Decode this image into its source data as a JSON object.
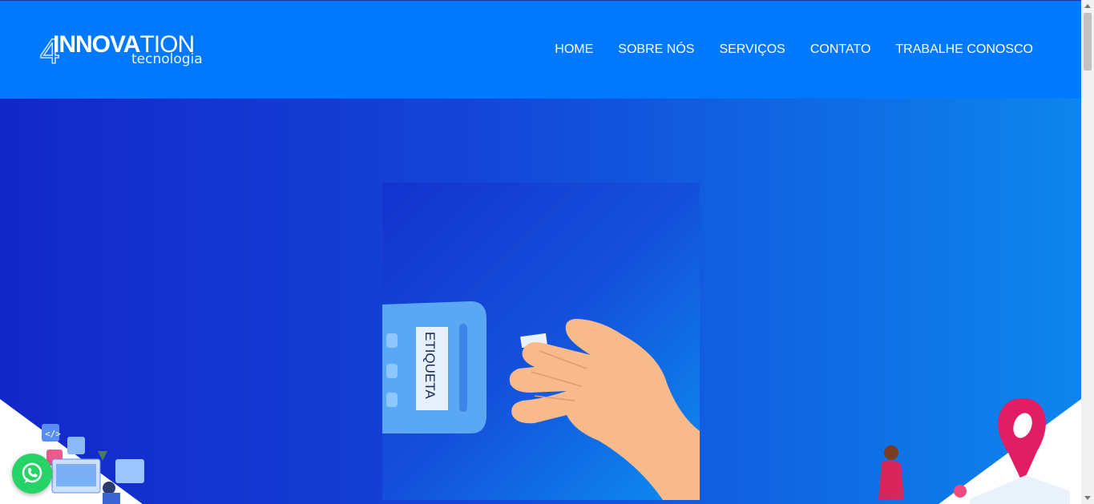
{
  "brand": {
    "logo_main_bold": "INNOVA",
    "logo_main_thin": "TION",
    "logo_digit": "4",
    "logo_sub": "tecnologia"
  },
  "nav": {
    "items": [
      "HOME",
      "SOBRE NÓS",
      "SERVIÇOS",
      "CONTATO",
      "TRABALHE CONOSCO"
    ]
  },
  "hero": {
    "label_text": "ETIQUETA"
  },
  "colors": {
    "header_bg": "#0079ff",
    "hero_gradient_start": "#1327c9",
    "hero_gradient_end": "#0d86ec",
    "whatsapp": "#25d366"
  },
  "icons": {
    "whatsapp": "whatsapp-icon",
    "scroll_up": "arrow-up-icon",
    "scroll_down": "arrow-down-icon"
  }
}
